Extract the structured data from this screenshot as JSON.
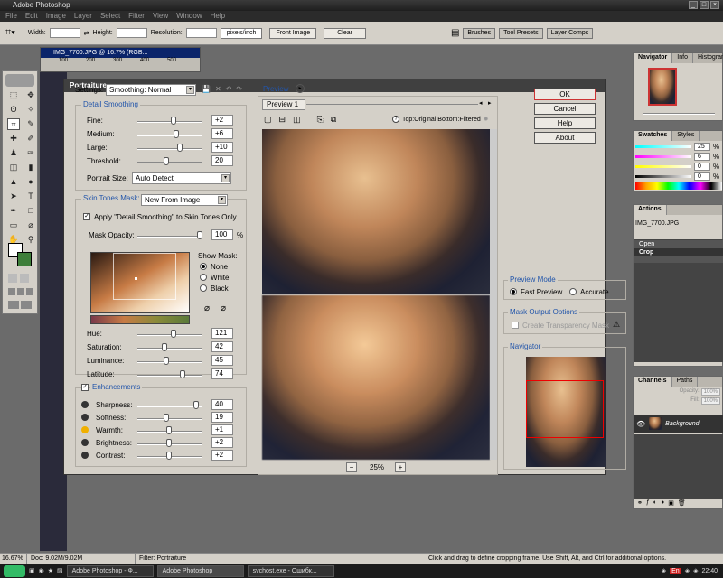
{
  "app": {
    "title": "Adobe Photoshop"
  },
  "menu": [
    "File",
    "Edit",
    "Image",
    "Layer",
    "Select",
    "Filter",
    "View",
    "Window",
    "Help"
  ],
  "options": {
    "width_label": "Width:",
    "height_label": "Height:",
    "resolution_label": "Resolution:",
    "units_value": "pixels/inch",
    "front_image": "Front Image",
    "clear": "Clear",
    "wells": [
      "Brushes",
      "Tool Presets",
      "Layer Comps"
    ]
  },
  "document": {
    "title": "IMG_7700.JPG @ 16.7% (RGB...",
    "ruler": [
      "100",
      "200",
      "300",
      "400",
      "500"
    ]
  },
  "dialog": {
    "title": "Portraiture",
    "settings_label": "Settings:",
    "settings_value": "Smoothing: Normal",
    "detail": {
      "title": "Detail Smoothing",
      "rows": [
        {
          "label": "Fine:",
          "value": "+2",
          "pos": 0.55
        },
        {
          "label": "Medium:",
          "value": "+6",
          "pos": 0.6
        },
        {
          "label": "Large:",
          "value": "+10",
          "pos": 0.65
        },
        {
          "label": "Threshold:",
          "value": "20",
          "pos": 0.45
        }
      ],
      "portrait_size_label": "Portrait Size:",
      "portrait_size_value": "Auto Detect"
    },
    "skin": {
      "title": "Skin Tones Mask:",
      "mode": "New From Image",
      "apply_label": "Apply \"Detail Smoothing\" to Skin Tones Only",
      "opacity_label": "Mask Opacity:",
      "opacity_value": "100",
      "opacity_unit": "%",
      "show_mask": "Show Mask:",
      "show_options": [
        "None",
        "White",
        "Black"
      ],
      "rows": [
        {
          "label": "Hue:",
          "value": "121",
          "pos": 0.55
        },
        {
          "label": "Saturation:",
          "value": "42",
          "pos": 0.42
        },
        {
          "label": "Luminance:",
          "value": "45",
          "pos": 0.45
        },
        {
          "label": "Latitude:",
          "value": "74",
          "pos": 0.7
        }
      ]
    },
    "enh": {
      "title": "Enhancements",
      "rows": [
        {
          "label": "Sharpness:",
          "value": "40",
          "pos": 0.9
        },
        {
          "label": "Softness:",
          "value": "19",
          "pos": 0.45
        },
        {
          "label": "Warmth:",
          "value": "+1",
          "pos": 0.48
        },
        {
          "label": "Brightness:",
          "value": "+2",
          "pos": 0.48
        },
        {
          "label": "Contrast:",
          "value": "+2",
          "pos": 0.48
        }
      ]
    },
    "preview": {
      "label": "Preview",
      "tab": "Preview 1",
      "layout_text": "Top:Original Bottom:Filtered",
      "zoom": "25%"
    },
    "buttons": [
      "OK",
      "Cancel",
      "Help",
      "About"
    ],
    "preview_mode": {
      "title": "Preview Mode",
      "fast": "Fast Preview",
      "accurate": "Accurate"
    },
    "mask_output": {
      "title": "Mask Output Options",
      "transparency": "Create Transparency Mask"
    },
    "navigator_title": "Navigator"
  },
  "panels": {
    "nav_tabs": [
      "Navigator",
      "Info",
      "Histogram"
    ],
    "swatch_tabs": [
      "Swatches",
      "Styles"
    ],
    "sliders": [
      {
        "value": "25",
        "unit": "%"
      },
      {
        "value": "6",
        "unit": "%"
      },
      {
        "value": "0",
        "unit": "%"
      },
      {
        "value": "0",
        "unit": "%"
      }
    ],
    "actions_tab": "Actions",
    "history_file": "IMG_7700.JPG",
    "history": [
      "Open",
      "Crop"
    ],
    "layer_tabs": [
      "Channels",
      "Paths"
    ],
    "opacity_label": "Opacity:",
    "opacity_val": "100%",
    "fill_label": "Fill:",
    "fill_val": "100%",
    "layer_name": "Background"
  },
  "status": {
    "zoom": "16.67%",
    "doc": "Doc: 9.02M/9.02M",
    "filter": "Filter: Portraiture",
    "hint": "Click and drag to define cropping frame. Use Shift, Alt, and Ctrl for additional options."
  },
  "taskbar": {
    "tasks": [
      "Adobe Photoshop - Ф...",
      "Adobe Photoshop",
      "svchost.exe - Ошибк..."
    ],
    "lang": "En",
    "time": "22:40"
  }
}
